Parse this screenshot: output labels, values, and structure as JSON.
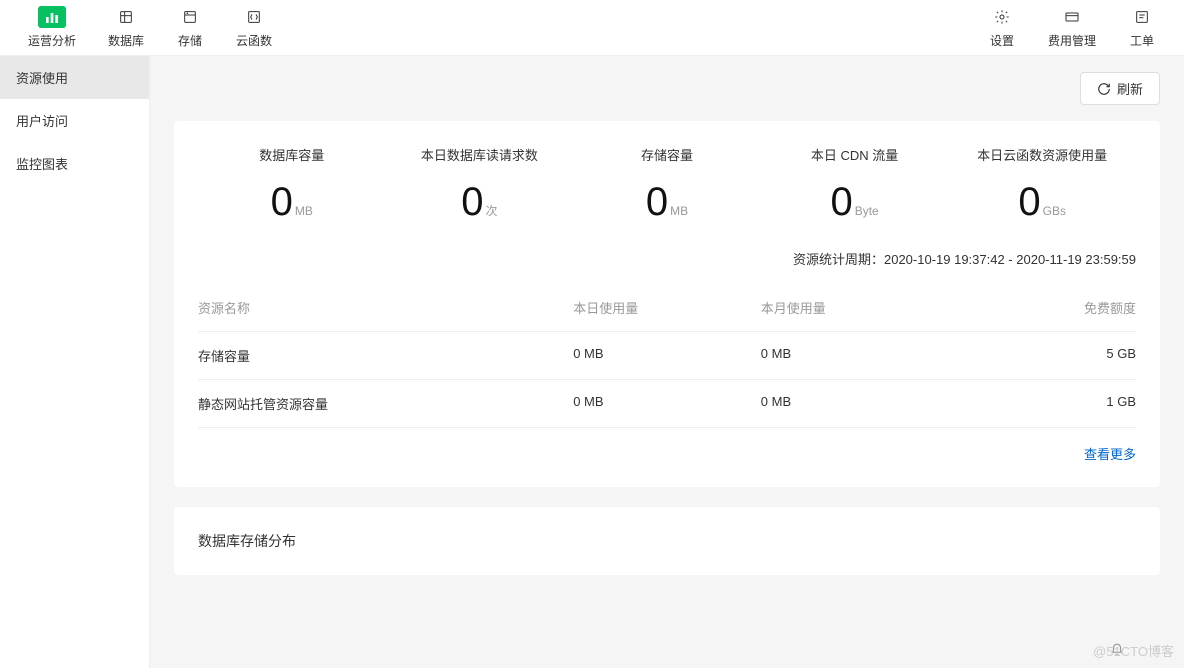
{
  "topnav": {
    "left": [
      {
        "label": "运营分析",
        "active": true
      },
      {
        "label": "数据库",
        "active": false
      },
      {
        "label": "存储",
        "active": false
      },
      {
        "label": "云函数",
        "active": false
      }
    ],
    "right": [
      {
        "label": "设置"
      },
      {
        "label": "费用管理"
      },
      {
        "label": "工单"
      }
    ]
  },
  "sidebar": {
    "items": [
      {
        "label": "资源使用",
        "active": true
      },
      {
        "label": "用户访问",
        "active": false
      },
      {
        "label": "监控图表",
        "active": false
      }
    ]
  },
  "refresh_label": "刷新",
  "stats": [
    {
      "label": "数据库容量",
      "value": "0",
      "unit": "MB"
    },
    {
      "label": "本日数据库读请求数",
      "value": "0",
      "unit": "次"
    },
    {
      "label": "存储容量",
      "value": "0",
      "unit": "MB"
    },
    {
      "label": "本日 CDN 流量",
      "value": "0",
      "unit": "Byte"
    },
    {
      "label": "本日云函数资源使用量",
      "value": "0",
      "unit": "GBs"
    }
  ],
  "period_prefix": "资源统计周期：",
  "period_range": "2020-10-19 19:37:42 - 2020-11-19 23:59:59",
  "table": {
    "headers": {
      "name": "资源名称",
      "today": "本日使用量",
      "month": "本月使用量",
      "quota": "免费额度"
    },
    "rows": [
      {
        "name": "存储容量",
        "today": "0 MB",
        "month": "0 MB",
        "quota": "5 GB"
      },
      {
        "name": "静态网站托管资源容量",
        "today": "0 MB",
        "month": "0 MB",
        "quota": "1 GB"
      }
    ]
  },
  "view_more": "查看更多",
  "db_section_title": "数据库存储分布",
  "watermark": "@51CTO博客"
}
